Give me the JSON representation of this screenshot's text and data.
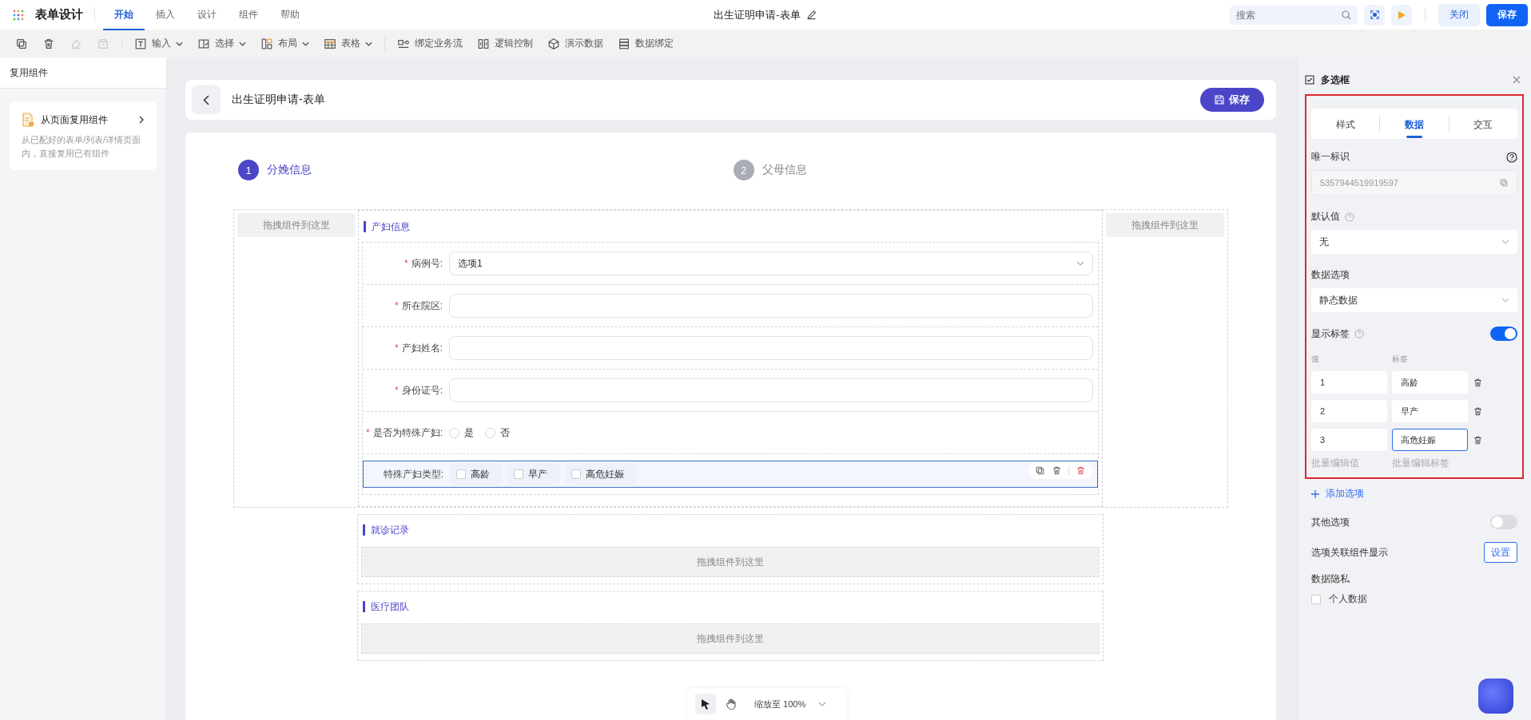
{
  "app": {
    "title": "表单设计"
  },
  "menu": [
    {
      "label": "开始",
      "selected": true
    },
    {
      "label": "插入",
      "selected": false
    },
    {
      "label": "设计",
      "selected": false
    },
    {
      "label": "组件",
      "selected": false
    },
    {
      "label": "帮助",
      "selected": false
    }
  ],
  "document_title": "出生证明申请-表单",
  "search": {
    "placeholder": "搜索"
  },
  "header_buttons": [
    {
      "label": "关闭",
      "kind": "secondary"
    },
    {
      "label": "保存",
      "kind": "primary"
    }
  ],
  "toolbar": [
    {
      "kind": "icon",
      "disabled": false
    },
    {
      "kind": "icon",
      "disabled": false
    },
    {
      "kind": "icon",
      "disabled": true
    },
    {
      "kind": "icon",
      "disabled": true
    },
    {
      "kind": "dropdown",
      "label": "输入",
      "disabled": false
    },
    {
      "kind": "dropdown",
      "label": "选择",
      "disabled": false
    },
    {
      "kind": "dropdown",
      "label": "布局",
      "disabled": false
    },
    {
      "kind": "dropdown",
      "label": "表格",
      "disabled": false
    },
    {
      "kind": "action",
      "label": "绑定业务流",
      "disabled": false
    },
    {
      "kind": "action",
      "label": "逻辑控制",
      "disabled": false
    },
    {
      "kind": "action",
      "label": "演示数据",
      "disabled": false
    },
    {
      "kind": "action",
      "label": "数据绑定",
      "disabled": false
    }
  ],
  "left_panel": {
    "title": "复用组件",
    "card": {
      "title": "从页面复用组件",
      "description": "从已配好的表单/列表/详情页面内，直接复用已有组件"
    }
  },
  "page_header": {
    "title": "出生证明申请-表单",
    "save_button": "保存"
  },
  "steps": [
    {
      "number": "1",
      "label": "分娩信息",
      "selected": true
    },
    {
      "number": "2",
      "label": "父母信息",
      "selected": false
    }
  ],
  "side_drop_zones": [
    "拖拽组件到这里",
    "拖拽组件到这里"
  ],
  "main_section": {
    "title": "产妇信息",
    "fields": [
      {
        "kind": "select",
        "label": "病例号:",
        "required_mark": "*",
        "value": "选项1",
        "selected": false
      },
      {
        "kind": "input",
        "label": "所在院区:",
        "required_mark": "*",
        "selected": false
      },
      {
        "kind": "input",
        "label": "产妇姓名:",
        "required_mark": "*",
        "selected": false
      },
      {
        "kind": "input",
        "label": "身份证号:",
        "required_mark": "*",
        "selected": false
      },
      {
        "kind": "radio",
        "label": "是否为特殊产妇:",
        "required_mark": "*",
        "selected": false,
        "options": [
          {
            "label": "是",
            "selected": false
          },
          {
            "label": "否",
            "selected": false
          }
        ]
      },
      {
        "kind": "checkbox",
        "label": "特殊产妇类型:",
        "selected": true,
        "options": [
          {
            "label": "高龄",
            "checked": false
          },
          {
            "label": "早产",
            "checked": false
          },
          {
            "label": "高危妊娠",
            "checked": false
          }
        ]
      }
    ]
  },
  "other_sections": [
    {
      "title": "就诊记录",
      "drop_zone": "拖拽组件到这里"
    },
    {
      "title": "医疗团队",
      "drop_zone": "拖拽组件到这里"
    }
  ],
  "zoom_bar": {
    "tools": [
      {
        "selected": true
      },
      {
        "selected": false
      }
    ],
    "label": "缩放至 100%"
  },
  "properties": {
    "title": "多选框",
    "tabs": [
      {
        "label": "样式",
        "selected": false
      },
      {
        "label": "数据",
        "selected": true
      },
      {
        "label": "交互",
        "selected": false
      }
    ],
    "unique_id": {
      "label": "唯一标识",
      "value": "5357944519919597"
    },
    "default_value": {
      "label": "默认值",
      "value": "无"
    },
    "data_options": {
      "label": "数据选项",
      "value": "静态数据"
    },
    "show_label": {
      "label": "显示标签",
      "on": true
    },
    "option_columns": [
      "值",
      "标签"
    ],
    "options": [
      {
        "value": "1",
        "label": "高龄",
        "focused": false
      },
      {
        "value": "2",
        "label": "早产",
        "focused": false
      },
      {
        "value": "3",
        "label": "高危妊娠",
        "focused": true
      }
    ],
    "batch_links": [
      "批量编辑值",
      "批量编辑标签"
    ],
    "add_option": "添加选项",
    "other_option": {
      "label": "其他选项",
      "on": false
    },
    "linked_display": {
      "label": "选项关联组件显示",
      "button": "设置"
    },
    "privacy": {
      "label": "数据隐私",
      "checkbox": {
        "label": "个人数据",
        "checked": false
      }
    }
  }
}
